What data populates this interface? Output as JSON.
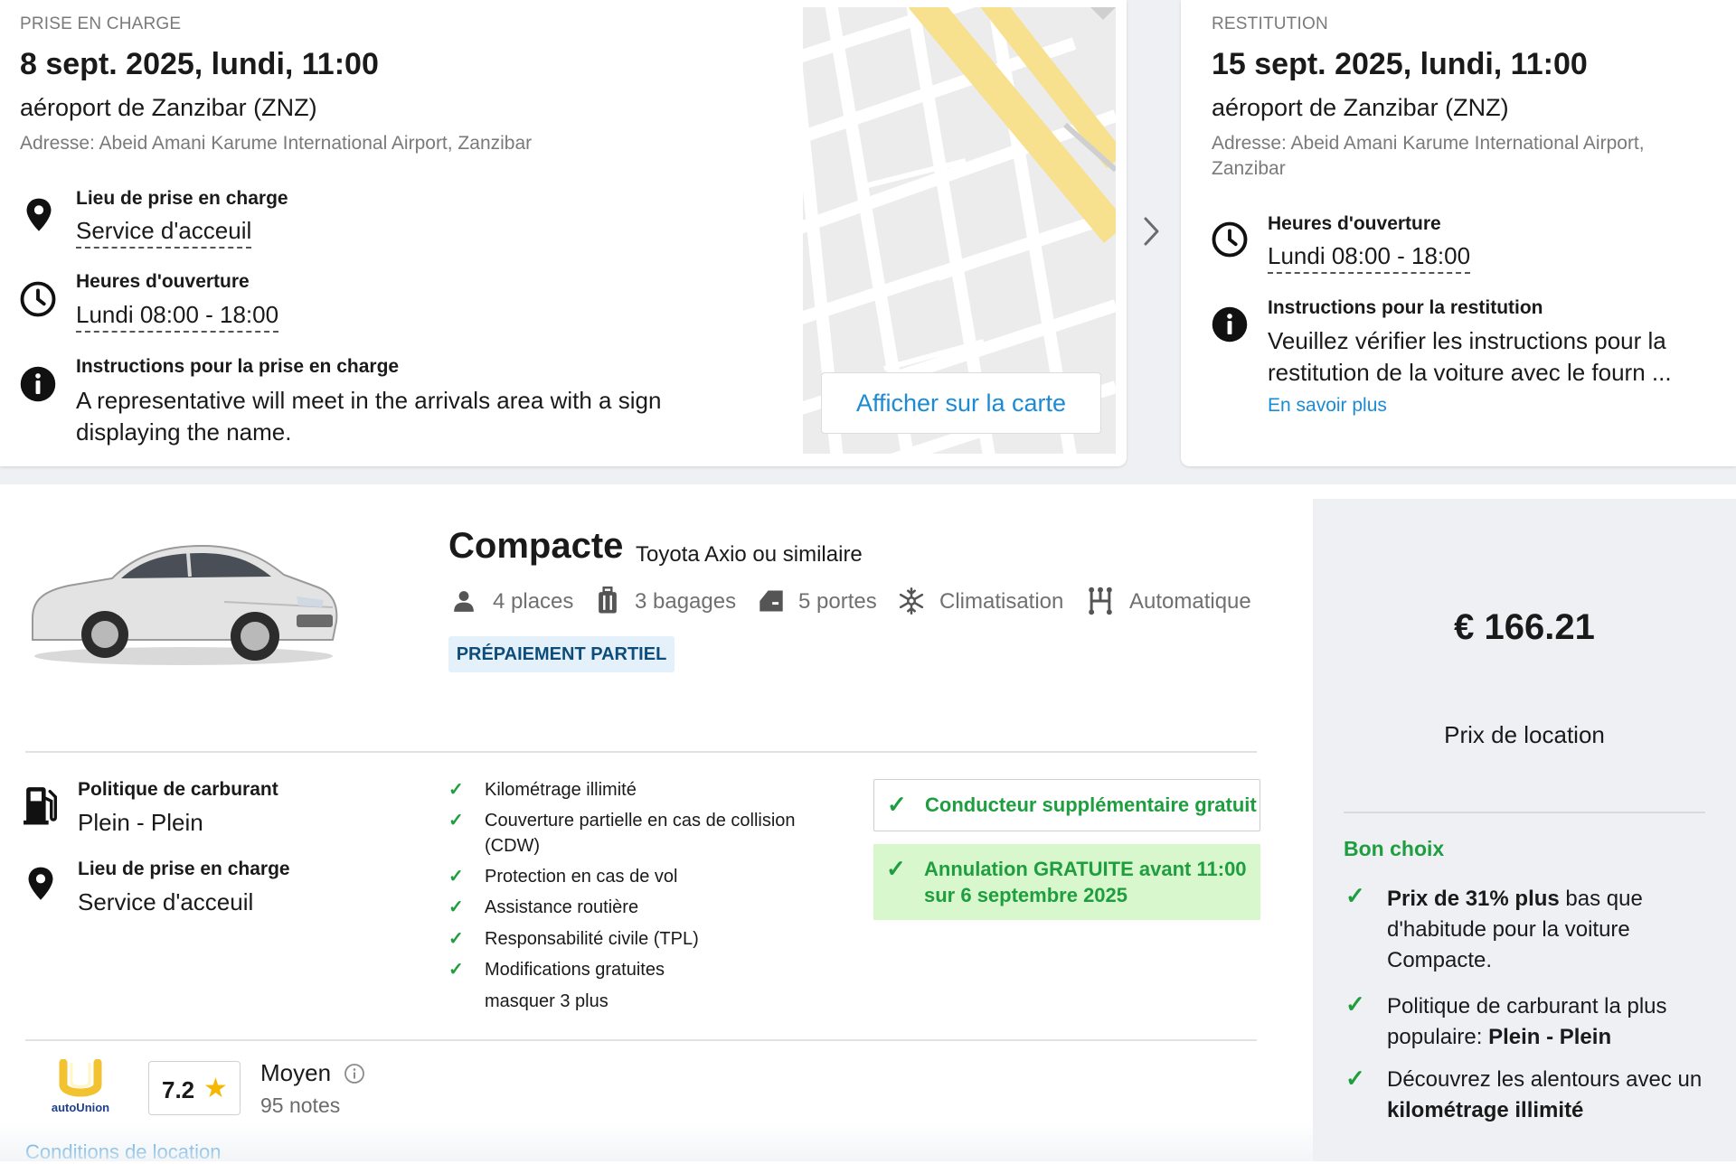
{
  "pickup": {
    "section_label": "PRISE EN CHARGE",
    "date": "8 sept. 2025, lundi, 11:00",
    "place": "aéroport de Zanzibar (ZNZ)",
    "address": "Adresse: Abeid Amani Karume International Airport, Zanzibar",
    "location_title": "Lieu de prise en charge",
    "location_value": "Service d'acceuil",
    "hours_title": "Heures d'ouverture",
    "hours_value": "Lundi 08:00 - 18:00",
    "instructions_title": "Instructions pour la prise en charge",
    "instructions_line1": "A representative will meet in the arrivals area with a sign",
    "instructions_line2": "displaying the name.",
    "map_button": "Afficher sur la carte"
  },
  "return": {
    "section_label": "RESTITUTION",
    "date": "15 sept. 2025, lundi, 11:00",
    "place": "aéroport de Zanzibar (ZNZ)",
    "address_line1": "Adresse: Abeid Amani Karume International Airport,",
    "address_line2": "Zanzibar",
    "hours_title": "Heures d'ouverture",
    "hours_value": "Lundi 08:00 - 18:00",
    "instructions_title": "Instructions pour la restitution",
    "instructions_line1": "Veuillez vérifier les instructions pour la",
    "instructions_line2": "restitution de la voiture avec le fourn ...",
    "learn_more": "En savoir plus"
  },
  "car": {
    "category": "Compacte",
    "model": "Toyota Axio ou similaire",
    "features": {
      "seats": "4 places",
      "bags": "3 bagages",
      "doors": "5 portes",
      "ac": "Climatisation",
      "transmission": "Automatique"
    },
    "badge": "PRÉPAIEMENT PARTIEL"
  },
  "fuel": {
    "title": "Politique de carburant",
    "value": "Plein - Plein"
  },
  "pickup_location": {
    "title": "Lieu de prise en charge",
    "value": "Service d'acceuil"
  },
  "inclusions": {
    "items": [
      "Kilométrage illimité",
      "Couverture partielle en cas de collision",
      "(CDW)",
      "Protection en cas de vol",
      "Assistance routière",
      "Responsabilité civile (TPL)",
      "Modifications gratuites"
    ],
    "toggle": "masquer 3 plus"
  },
  "perks": {
    "free_driver": "Conducteur supplémentaire gratuit",
    "cancel_line1": "Annulation GRATUITE avant 11:00",
    "cancel_line2": "sur 6 septembre 2025"
  },
  "supplier": {
    "logo_text": "autoUnion",
    "score": "7.2",
    "rating_label": "Moyen",
    "reviews": "95 notes"
  },
  "conditions_link": "Conditions de location",
  "price": {
    "amount": "€ 166.21",
    "label": "Prix de location",
    "good_choice": "Bon choix",
    "reason1_bold": "Prix de 31% plus",
    "reason1_rest": " bas que",
    "reason1_line2": "d'habitude pour la voiture",
    "reason1_line3": "Compacte.",
    "reason2_line1": "Politique de carburant la plus",
    "reason2_line2_prefix": "populaire: ",
    "reason2_bold": "Plein - Plein",
    "reason3_line1": "Découvrez les alentours avec un",
    "reason3_bold": "kilométrage illimité"
  },
  "colors": {
    "accent_link": "#1b8bd6",
    "success_green": "#1e9e3e",
    "badge_bg": "#e4f1fb",
    "cancel_bg": "#d9f7cc",
    "panel_bg": "#eef0f3"
  },
  "icons": [
    "location-pin-icon",
    "clock-icon",
    "info-icon",
    "chevron-right-icon",
    "person-icon",
    "luggage-icon",
    "door-icon",
    "snowflake-icon",
    "gearshift-icon",
    "fuel-pump-icon",
    "check-icon",
    "star-icon",
    "info-outline-icon"
  ]
}
